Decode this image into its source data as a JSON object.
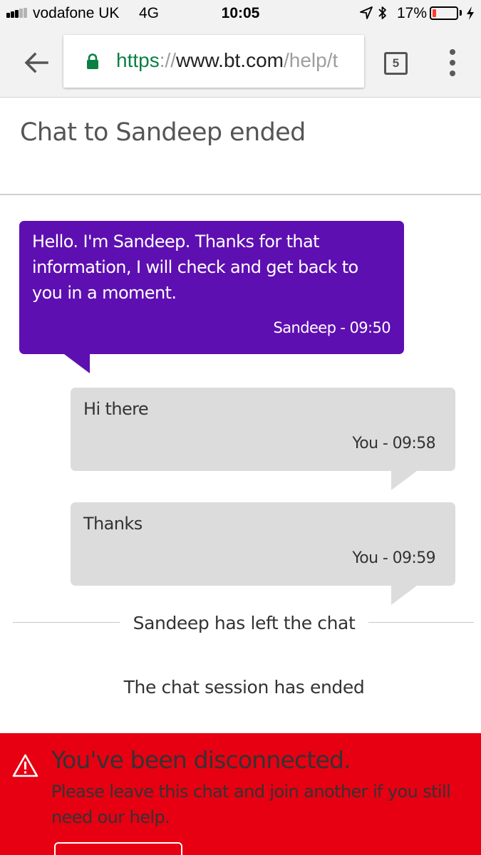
{
  "status_bar": {
    "carrier": "vodafone UK",
    "network": "4G",
    "time": "10:05",
    "battery_percent": "17%",
    "battery_level": 0.17,
    "signal_bars_filled": 3,
    "signal_bars_total": 5
  },
  "browser": {
    "url_scheme": "https",
    "url_separator": "://",
    "url_host": "www.bt.com",
    "url_path": "/help/t",
    "tab_count": "5"
  },
  "chat": {
    "title": "Chat to Sandeep ended",
    "messages": [
      {
        "from": "agent",
        "text": "Hello. I'm Sandeep. Thanks for that information, I will check and get back to you in a moment.",
        "meta": "Sandeep - 09:50"
      },
      {
        "from": "user",
        "text": "Hi there",
        "meta": "You - 09:58"
      },
      {
        "from": "user",
        "text": "Thanks",
        "meta": "You - 09:59"
      }
    ],
    "left_notice": "Sandeep has left the chat",
    "ended_notice": "The chat session has ended"
  },
  "alert": {
    "title": "You've been disconnected.",
    "body": "Please leave this chat and join another if you still need our help."
  },
  "colors": {
    "agent_bubble": "#5e0fb1",
    "user_bubble": "#dcdcdc",
    "alert_background": "#e60012",
    "secure_green": "#0b8043",
    "battery_low": "#ff3b30"
  },
  "icons": {
    "back": "arrow-left-icon",
    "lock": "lock-icon",
    "menu": "more-vertical-icon",
    "location": "location-arrow-icon",
    "bluetooth": "bluetooth-icon",
    "charging": "bolt-icon",
    "warning": "warning-triangle-icon"
  }
}
